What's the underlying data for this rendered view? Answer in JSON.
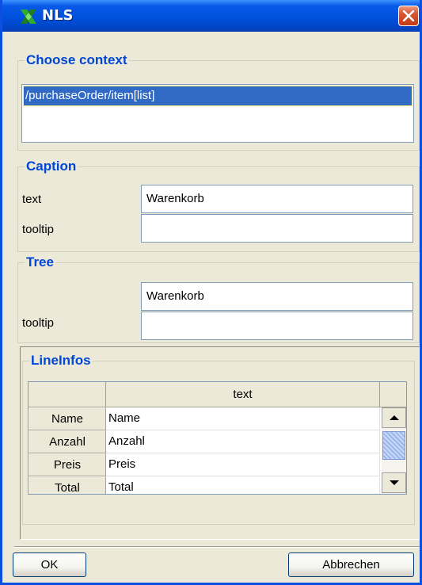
{
  "window": {
    "title": "NLS",
    "logo_icon": "nls-logo-icon",
    "close_icon": "close-icon"
  },
  "choose_context": {
    "legend": "Choose context",
    "items": [
      "/purchaseOrder/item[list]"
    ]
  },
  "caption": {
    "legend": "Caption",
    "text_label": "text",
    "text_value": "Warenkorb",
    "tooltip_label": "tooltip",
    "tooltip_value": ""
  },
  "tree": {
    "legend": "Tree",
    "text_value": "Warenkorb",
    "tooltip_label": "tooltip",
    "tooltip_value": ""
  },
  "lineinfos": {
    "legend": "LineInfos",
    "column_header": "text",
    "rows": [
      {
        "header": "Name",
        "value": "Name"
      },
      {
        "header": "Anzahl",
        "value": "Anzahl"
      },
      {
        "header": "Preis",
        "value": "Preis"
      },
      {
        "header": "Total",
        "value": "Total"
      }
    ]
  },
  "buttons": {
    "ok": "OK",
    "cancel": "Abbrechen"
  },
  "colors": {
    "titlebar": "#0052de",
    "legend": "#0046d5",
    "selection": "#316ac5",
    "close": "#d9542f"
  }
}
